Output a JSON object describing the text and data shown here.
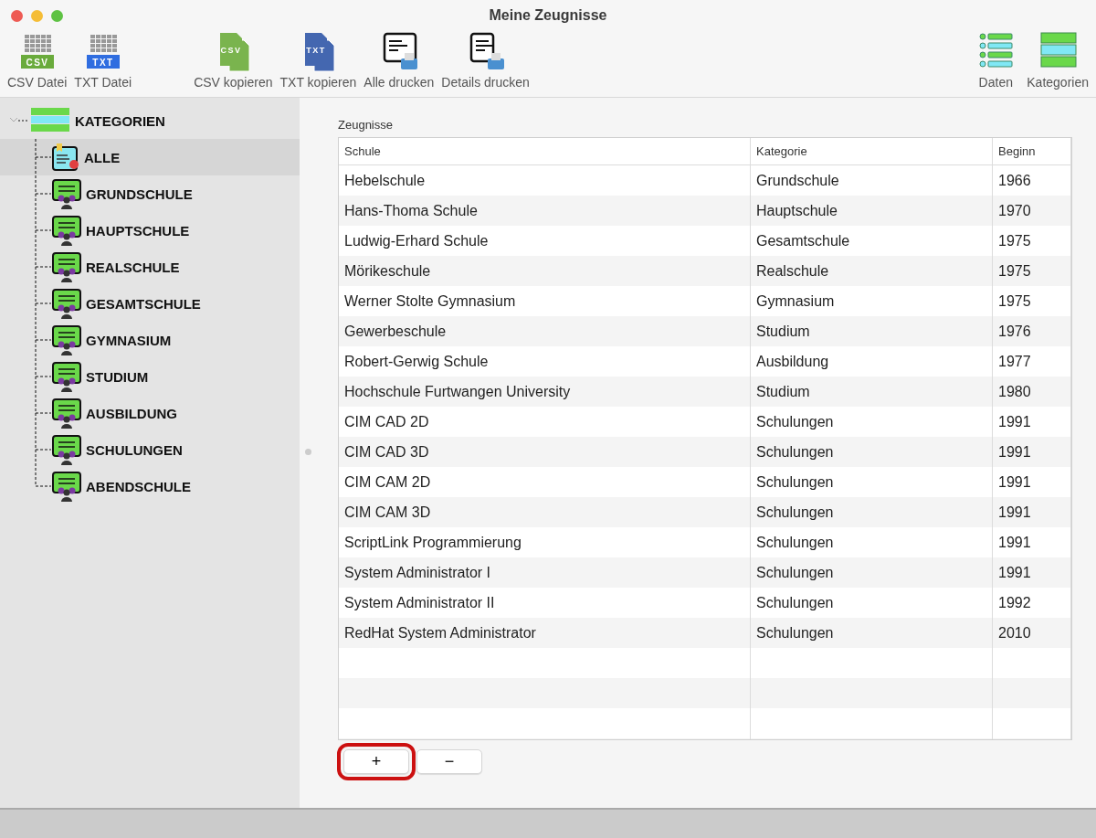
{
  "window": {
    "title": "Meine Zeugnisse"
  },
  "toolbar": {
    "left": [
      {
        "label": "CSV Datei",
        "kind": "file",
        "badge": "CSV",
        "color": "#6aab3c"
      },
      {
        "label": "TXT Datei",
        "kind": "file",
        "badge": "TXT",
        "color": "#2f6de0"
      },
      {
        "label": "CSV kopieren",
        "kind": "copy",
        "badge": "CSV",
        "color": "#7ab44e"
      },
      {
        "label": "TXT kopieren",
        "kind": "copy",
        "badge": "TXT",
        "color": "#4467b0"
      },
      {
        "label": "Alle drucken",
        "kind": "print"
      },
      {
        "label": "Details drucken",
        "kind": "print-detail"
      }
    ],
    "right": [
      {
        "label": "Daten",
        "kind": "list"
      },
      {
        "label": "Kategorien",
        "kind": "bars"
      }
    ]
  },
  "sidebar": {
    "root": {
      "label": "KATEGORIEN",
      "expanded": true,
      "children": [
        {
          "label": "ALLE",
          "kind": "all",
          "selected": true
        },
        {
          "label": "GRUNDSCHULE",
          "kind": "category",
          "selected": false
        },
        {
          "label": "HAUPTSCHULE",
          "kind": "category",
          "selected": false
        },
        {
          "label": "REALSCHULE",
          "kind": "category",
          "selected": false
        },
        {
          "label": "GESAMTSCHULE",
          "kind": "category",
          "selected": false
        },
        {
          "label": "GYMNASIUM",
          "kind": "category",
          "selected": false
        },
        {
          "label": "STUDIUM",
          "kind": "category",
          "selected": false
        },
        {
          "label": "AUSBILDUNG",
          "kind": "category",
          "selected": false
        },
        {
          "label": "SCHULUNGEN",
          "kind": "category",
          "selected": false
        },
        {
          "label": "ABENDSCHULE",
          "kind": "category",
          "selected": false
        }
      ]
    }
  },
  "table": {
    "title": "Zeugnisse",
    "columns": [
      "Schule",
      "Kategorie",
      "Beginn"
    ],
    "rows": [
      [
        "Hebelschule",
        "Grundschule",
        "1966"
      ],
      [
        "Hans-Thoma Schule",
        "Hauptschule",
        "1970"
      ],
      [
        "Ludwig-Erhard Schule",
        "Gesamtschule",
        "1975"
      ],
      [
        "Mörikeschule",
        "Realschule",
        "1975"
      ],
      [
        "Werner Stolte Gymnasium",
        "Gymnasium",
        "1975"
      ],
      [
        "Gewerbeschule",
        "Studium",
        "1976"
      ],
      [
        "Robert-Gerwig Schule",
        "Ausbildung",
        "1977"
      ],
      [
        "Hochschule Furtwangen University",
        "Studium",
        "1980"
      ],
      [
        "CIM CAD 2D",
        "Schulungen",
        "1991"
      ],
      [
        "CIM CAD 3D",
        "Schulungen",
        "1991"
      ],
      [
        "CIM CAM 2D",
        "Schulungen",
        "1991"
      ],
      [
        "CIM CAM 3D",
        "Schulungen",
        "1991"
      ],
      [
        "ScriptLink Programmierung",
        "Schulungen",
        "1991"
      ],
      [
        "System Administrator I",
        "Schulungen",
        "1991"
      ],
      [
        "System Administrator II",
        "Schulungen",
        "1992"
      ],
      [
        "RedHat System Administrator",
        "Schulungen",
        "2010"
      ]
    ]
  },
  "buttons": [
    {
      "label": "+",
      "highlighted": true
    },
    {
      "label": "−",
      "highlighted": false
    }
  ]
}
